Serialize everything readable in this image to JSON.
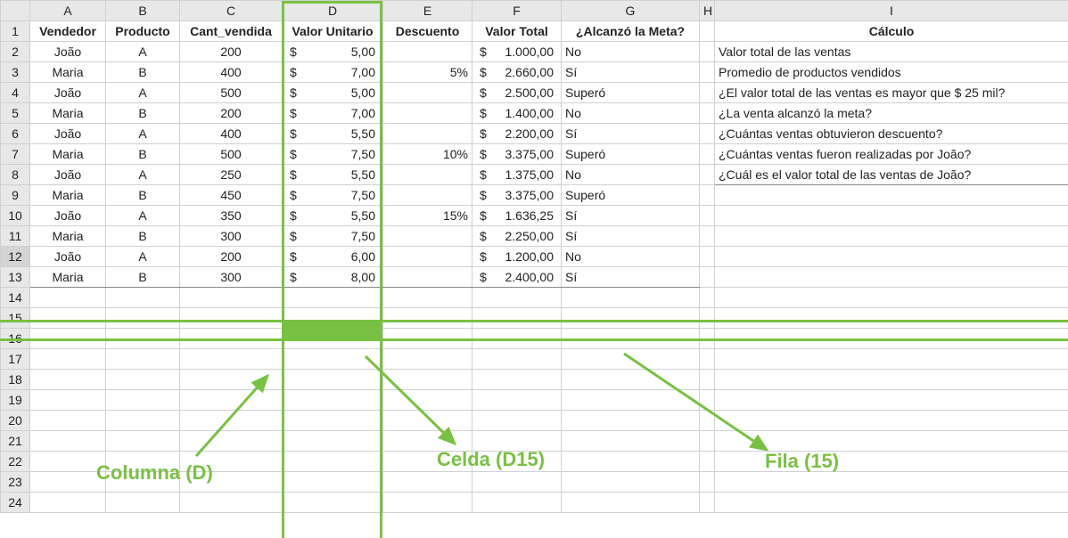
{
  "columns": [
    "",
    "A",
    "B",
    "C",
    "D",
    "E",
    "F",
    "G",
    "H",
    "I"
  ],
  "rowCount": 24,
  "headers": {
    "A": "Vendedor",
    "B": "Producto",
    "C": "Cant_vendida",
    "D": "Valor Unitario",
    "E": "Descuento",
    "F": "Valor Total",
    "G": "¿Alcanzó la Meta?",
    "I": "Cálculo"
  },
  "rows": [
    {
      "A": "João",
      "B": "A",
      "C": "200",
      "D": "5,00",
      "E": "",
      "F": "1.000,00",
      "G": "No",
      "I": "Valor total de las ventas"
    },
    {
      "A": "Maria",
      "B": "B",
      "C": "400",
      "D": "7,00",
      "E": "5%",
      "F": "2.660,00",
      "G": "Sí",
      "I": "Promedio de productos vendidos"
    },
    {
      "A": "João",
      "B": "A",
      "C": "500",
      "D": "5,00",
      "E": "",
      "F": "2.500,00",
      "G": "Superó",
      "I": "¿El valor total de las ventas es mayor que $ 25 mil?"
    },
    {
      "A": "Maria",
      "B": "B",
      "C": "200",
      "D": "7,00",
      "E": "",
      "F": "1.400,00",
      "G": "No",
      "I": "¿La venta alcanzó la meta?"
    },
    {
      "A": "João",
      "B": "A",
      "C": "400",
      "D": "5,50",
      "E": "",
      "F": "2.200,00",
      "G": "Sí",
      "I": "¿Cuántas ventas obtuvieron descuento?"
    },
    {
      "A": "Maria",
      "B": "B",
      "C": "500",
      "D": "7,50",
      "E": "10%",
      "F": "3.375,00",
      "G": "Superó",
      "I": "¿Cuántas ventas fueron realizadas por João?"
    },
    {
      "A": "João",
      "B": "A",
      "C": "250",
      "D": "5,50",
      "E": "",
      "F": "1.375,00",
      "G": "No",
      "I": "¿Cuál es el valor total de las ventas de João?"
    },
    {
      "A": "Maria",
      "B": "B",
      "C": "450",
      "D": "7,50",
      "E": "",
      "F": "3.375,00",
      "G": "Superó",
      "I": ""
    },
    {
      "A": "João",
      "B": "A",
      "C": "350",
      "D": "5,50",
      "E": "15%",
      "F": "1.636,25",
      "G": "Sí",
      "I": ""
    },
    {
      "A": "Maria",
      "B": "B",
      "C": "300",
      "D": "7,50",
      "E": "",
      "F": "2.250,00",
      "G": "Sí",
      "I": ""
    },
    {
      "A": "João",
      "B": "A",
      "C": "200",
      "D": "6,00",
      "E": "",
      "F": "1.200,00",
      "G": "No",
      "I": ""
    },
    {
      "A": "Maria",
      "B": "B",
      "C": "300",
      "D": "8,00",
      "E": "",
      "F": "2.400,00",
      "G": "Sí",
      "I": ""
    }
  ],
  "currency": "$",
  "annotations": {
    "column": "Columna (D)",
    "cell": "Celda (D15)",
    "row": "Fila (15)"
  },
  "highlight": {
    "column": "D",
    "row": 15,
    "cell": "D15"
  },
  "selectedRow": 12,
  "chart_data": {
    "type": "table",
    "title": "Tabla de ventas con columna D y fila 15 resaltadas",
    "columns": [
      "Vendedor",
      "Producto",
      "Cant_vendida",
      "Valor Unitario",
      "Descuento",
      "Valor Total",
      "¿Alcanzó la Meta?"
    ],
    "data": [
      [
        "João",
        "A",
        200,
        5.0,
        null,
        1000.0,
        "No"
      ],
      [
        "Maria",
        "B",
        400,
        7.0,
        0.05,
        2660.0,
        "Sí"
      ],
      [
        "João",
        "A",
        500,
        5.0,
        null,
        2500.0,
        "Superó"
      ],
      [
        "Maria",
        "B",
        200,
        7.0,
        null,
        1400.0,
        "No"
      ],
      [
        "João",
        "A",
        400,
        5.5,
        null,
        2200.0,
        "Sí"
      ],
      [
        "Maria",
        "B",
        500,
        7.5,
        0.1,
        3375.0,
        "Superó"
      ],
      [
        "João",
        "A",
        250,
        5.5,
        null,
        1375.0,
        "No"
      ],
      [
        "Maria",
        "B",
        450,
        7.5,
        null,
        3375.0,
        "Superó"
      ],
      [
        "João",
        "A",
        350,
        5.5,
        0.15,
        1636.25,
        "Sí"
      ],
      [
        "Maria",
        "B",
        300,
        7.5,
        null,
        2250.0,
        "Sí"
      ],
      [
        "João",
        "A",
        200,
        6.0,
        null,
        1200.0,
        "No"
      ],
      [
        "Maria",
        "B",
        300,
        8.0,
        null,
        2400.0,
        "Sí"
      ]
    ],
    "side_list_title": "Cálculo",
    "side_list": [
      "Valor total de las ventas",
      "Promedio de productos vendidos",
      "¿El valor total de las ventas es mayor que $ 25 mil?",
      "¿La venta alcanzó la meta?",
      "¿Cuántas ventas obtuvieron descuento?",
      "¿Cuántas ventas fueron realizadas por João?",
      "¿Cuál es el valor total de las ventas de João?"
    ]
  }
}
